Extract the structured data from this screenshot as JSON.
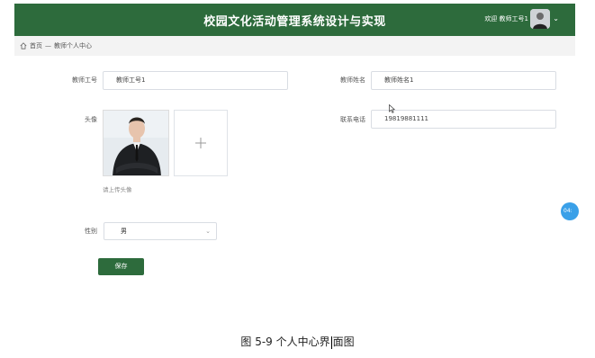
{
  "header": {
    "title": "校园文化活动管理系统设计与实现",
    "welcome": "欢迎 教师工号1",
    "bg_color": "#2d6b3c"
  },
  "breadcrumb": {
    "home": "首页",
    "separator": "—",
    "current": "教师个人中心"
  },
  "form": {
    "teacher_no_label": "教师工号",
    "teacher_no_value": "教师工号1",
    "teacher_name_label": "教师姓名",
    "teacher_name_value": "教师姓名1",
    "avatar_label": "头像",
    "upload_hint": "请上传头像",
    "phone_label": "联系电话",
    "phone_value": "19819881111",
    "gender_label": "性别",
    "gender_value": "男",
    "save_label": "保存"
  },
  "float_bubble": "04:",
  "caption": {
    "before": "图 5-9 个人中心界",
    "after": "面图"
  },
  "icons": {
    "home": "home-icon",
    "upload": "plus-icon",
    "select": "chevron-down-icon",
    "user": "user-avatar",
    "cursor": "mouse-cursor"
  }
}
